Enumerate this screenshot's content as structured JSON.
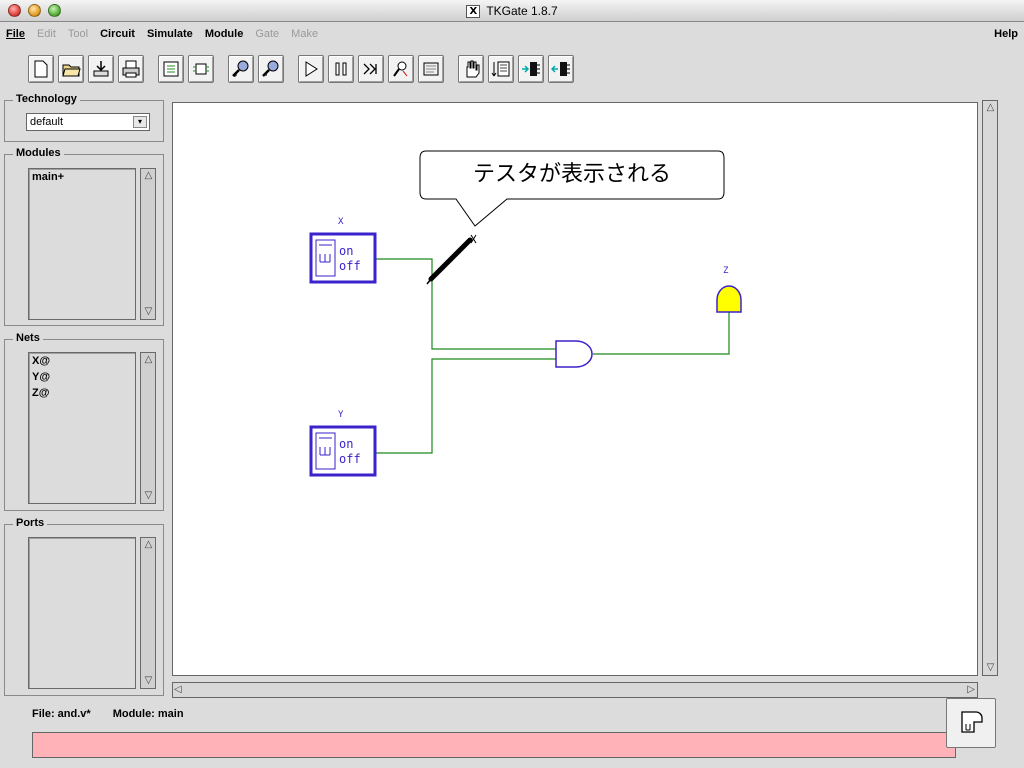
{
  "window": {
    "title": "TKGate 1.8.7"
  },
  "menu": {
    "file": "File",
    "edit": "Edit",
    "tool": "Tool",
    "circuit": "Circuit",
    "simulate": "Simulate",
    "module": "Module",
    "gate": "Gate",
    "make": "Make",
    "help": "Help"
  },
  "toolbar": {
    "icons": [
      "new-file-icon",
      "open-folder-icon",
      "save-icon",
      "print-icon",
      "module-tree-icon",
      "module-open-icon",
      "zoom-in-icon",
      "zoom-out-icon",
      "simulate-start-icon",
      "pause-icon",
      "step-icon",
      "probe-icon",
      "script-icon",
      "hand-icon",
      "io-icon",
      "pin-in-icon",
      "pin-out-icon"
    ]
  },
  "panels": {
    "technology": {
      "title": "Technology",
      "selected": "default"
    },
    "modules": {
      "title": "Modules",
      "items": [
        "main+"
      ]
    },
    "nets": {
      "title": "Nets",
      "items": [
        "X@",
        "Y@",
        "Z@"
      ]
    },
    "ports": {
      "title": "Ports",
      "items": []
    }
  },
  "canvas": {
    "switch_x_label": "X",
    "switch_y_label": "Y",
    "led_label": "Z",
    "switch_on": "on",
    "switch_off": "off",
    "callout": "テスタが表示される"
  },
  "status": {
    "file": "File: and.v*",
    "module": "Module: main"
  },
  "colors": {
    "wire": "#1a8a1a",
    "gate": "#3a22cc",
    "led": "#ffff00",
    "error_bar": "#ffb3b8"
  }
}
